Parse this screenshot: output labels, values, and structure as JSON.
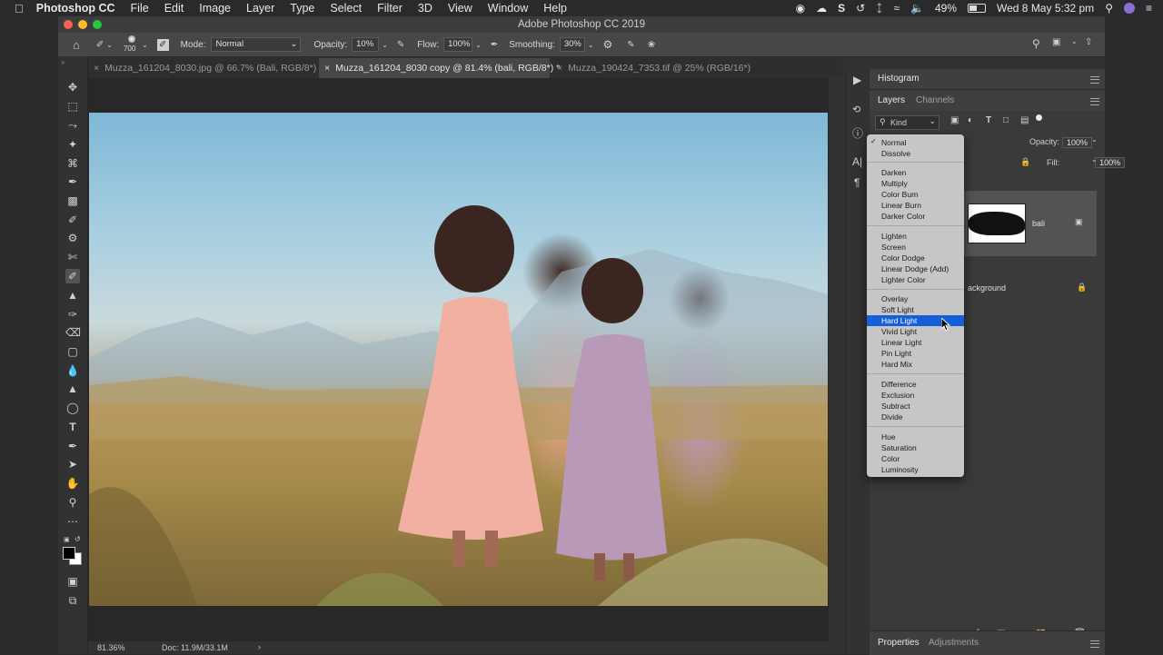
{
  "menubar": {
    "app_name": "Photoshop CC",
    "items": [
      "File",
      "Edit",
      "Image",
      "Layer",
      "Type",
      "Select",
      "Filter",
      "3D",
      "View",
      "Window",
      "Help"
    ],
    "battery": "49%",
    "datetime": "Wed 8 May  5:32 pm"
  },
  "window": {
    "title": "Adobe Photoshop CC 2019"
  },
  "options_bar": {
    "brush_size": "700",
    "mode_label": "Mode:",
    "mode_value": "Normal",
    "opacity_label": "Opacity:",
    "opacity_value": "10%",
    "flow_label": "Flow:",
    "flow_value": "100%",
    "smoothing_label": "Smoothing:",
    "smoothing_value": "30%"
  },
  "tabs": [
    {
      "label": "Muzza_161204_8030.jpg @ 66.7% (Bali, RGB/8*) *"
    },
    {
      "label": "Muzza_161204_8030 copy @ 81.4% (bali, RGB/8*) *"
    },
    {
      "label": "Muzza_190424_7353.tif @ 25% (RGB/16*)"
    }
  ],
  "status": {
    "zoom": "81.36%",
    "doc": "Doc: 11.9M/33.1M"
  },
  "panels": {
    "histogram": "Histogram",
    "layers_tab": "Layers",
    "channels_tab": "Channels",
    "kind": "Kind",
    "opacity_label": "Opacity:",
    "opacity_value": "100%",
    "fill_label": "Fill:",
    "fill_value": "100%",
    "layers": [
      {
        "name": "bali"
      },
      {
        "name": "ackground"
      }
    ],
    "properties_tab": "Properties",
    "adjustments_tab": "Adjustments"
  },
  "blend_menu": {
    "groups": [
      [
        "Normal",
        "Dissolve"
      ],
      [
        "Darken",
        "Multiply",
        "Color Burn",
        "Linear Burn",
        "Darker Color"
      ],
      [
        "Lighten",
        "Screen",
        "Color Dodge",
        "Linear Dodge (Add)",
        "Lighter Color"
      ],
      [
        "Overlay",
        "Soft Light",
        "Hard Light",
        "Vivid Light",
        "Linear Light",
        "Pin Light",
        "Hard Mix"
      ],
      [
        "Difference",
        "Exclusion",
        "Subtract",
        "Divide"
      ],
      [
        "Hue",
        "Saturation",
        "Color",
        "Luminosity"
      ]
    ],
    "checked": "Normal",
    "highlighted": "Hard Light"
  }
}
